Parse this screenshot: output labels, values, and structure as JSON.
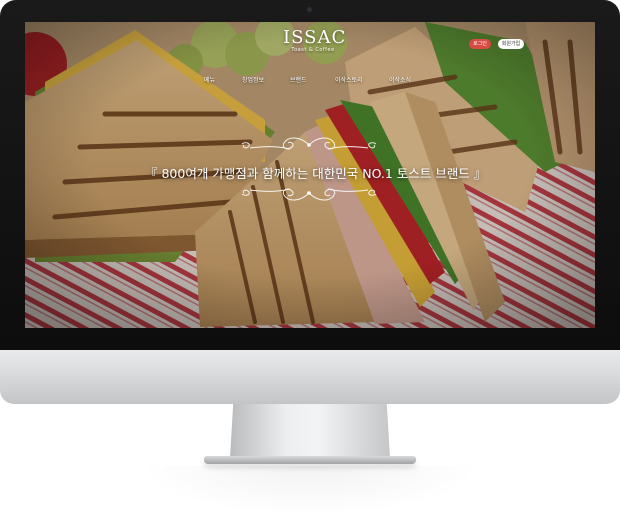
{
  "site": {
    "logo_text": "ISSAC",
    "logo_sub": "Toast & Coffee"
  },
  "nav": {
    "items": [
      {
        "label": "메뉴"
      },
      {
        "label": "창업정보"
      },
      {
        "label": "브랜드"
      },
      {
        "label": "이삭스토리"
      },
      {
        "label": "이삭소식"
      }
    ]
  },
  "header_buttons": {
    "login": "로그인",
    "join": "회원가입",
    "login_color": "#d94a44"
  },
  "hero": {
    "headline": "『 800여개 가맹점과 함께하는 대한민국 NO.1 토스트 브랜드 』"
  }
}
